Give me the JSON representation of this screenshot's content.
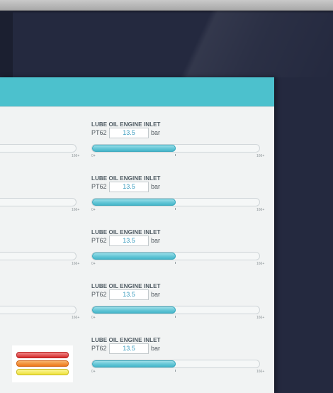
{
  "gauges": [
    {
      "title": "LUBE OIL ENGINE INLET",
      "tag": "PT62",
      "value": "13.5",
      "unit": "bar",
      "min_label": "0+",
      "max_label": "166+",
      "left_max_label": "166+",
      "fill_fraction": 0.5,
      "left_gauge_visible": true
    },
    {
      "title": "LUBE OIL ENGINE INLET",
      "tag": "PT62",
      "value": "13.5",
      "unit": "bar",
      "min_label": "0+",
      "max_label": "166+",
      "left_max_label": "166+",
      "fill_fraction": 0.5,
      "left_gauge_visible": true
    },
    {
      "title": "LUBE OIL ENGINE INLET",
      "tag": "PT62",
      "value": "13.5",
      "unit": "bar",
      "min_label": "0+",
      "max_label": "166+",
      "left_max_label": "166+",
      "fill_fraction": 0.5,
      "left_gauge_visible": true
    },
    {
      "title": "LUBE OIL ENGINE INLET",
      "tag": "PT62",
      "value": "13.5",
      "unit": "bar",
      "min_label": "0+",
      "max_label": "166+",
      "left_max_label": "166+",
      "fill_fraction": 0.5,
      "left_gauge_visible": true
    },
    {
      "title": "LUBE OIL ENGINE INLET",
      "tag": "PT62",
      "value": "13.5",
      "unit": "bar",
      "min_label": "0+",
      "max_label": "166+",
      "left_max_label": "",
      "fill_fraction": 0.5,
      "left_gauge_visible": false
    }
  ],
  "colors": {
    "header": "#4cc1cd",
    "fill": "#63c6d6",
    "value_text": "#3f9fc1",
    "legend": [
      "#d52b2b",
      "#ee7a1a",
      "#efe23a"
    ]
  }
}
